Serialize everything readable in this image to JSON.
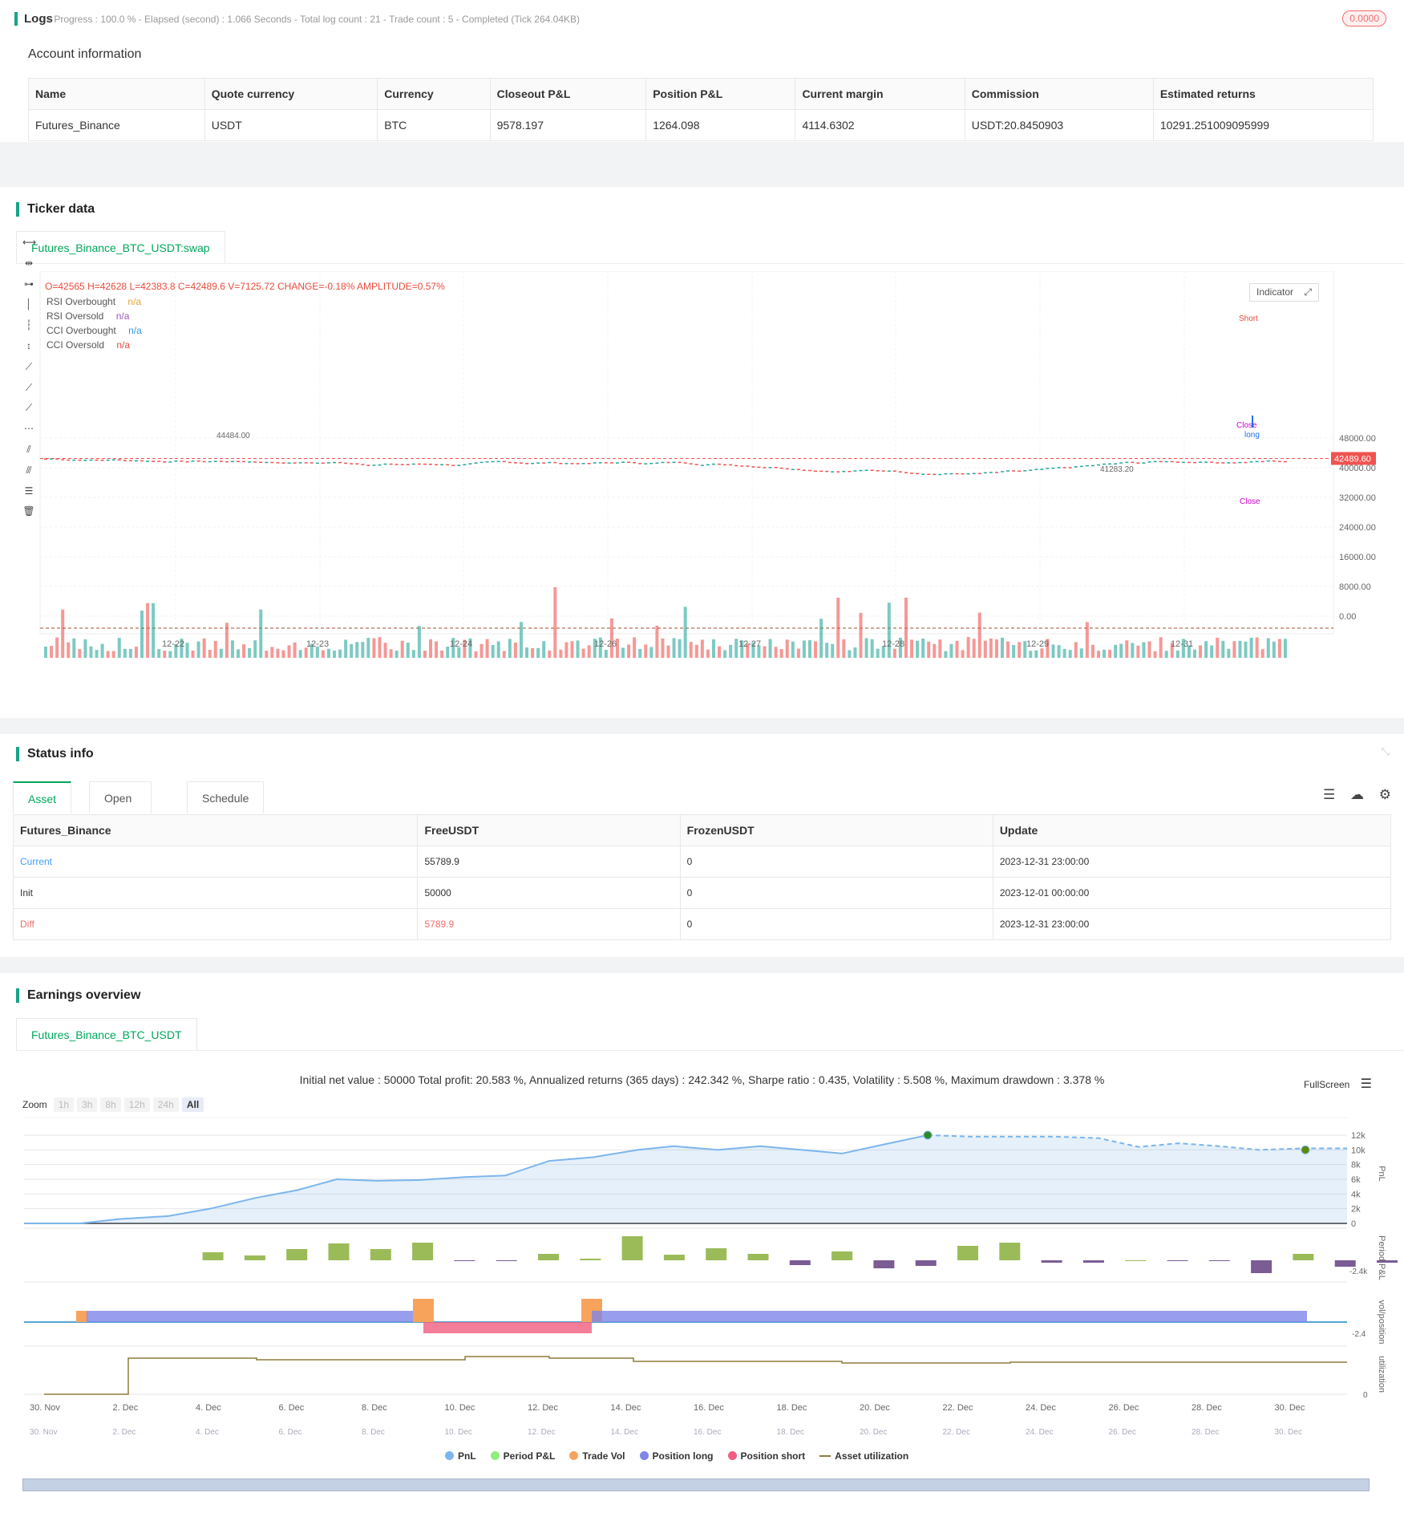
{
  "logs": {
    "title": "Logs",
    "status": "- Progress : 100.0 % - Elapsed (second) : 1.066  Seconds - Total log count : 21 - Trade count : 5 - Completed (Tick 264.04KB)",
    "badge": "0.0000"
  },
  "account": {
    "title": "Account information",
    "headers": [
      "Name",
      "Quote currency",
      "Currency",
      "Closeout P&L",
      "Position P&L",
      "Current margin",
      "Commission",
      "Estimated returns"
    ],
    "row": [
      "Futures_Binance",
      "USDT",
      "BTC",
      "9578.197",
      "1264.098",
      "4114.6302",
      "USDT:20.8450903",
      "10291.251009095999"
    ]
  },
  "ticker": {
    "title": "Ticker data",
    "tab": "Futures_Binance_BTC_USDT:swap",
    "ohlc": {
      "o": "O=42565",
      "h": "H=42628",
      "l": "L=42383.8",
      "c": "C=42489.6",
      "v": "V=7125.72",
      "change": "CHANGE=-0.18%",
      "amp": "AMPLITUDE=0.57%"
    },
    "indicators": [
      {
        "name": "RSI Overbought",
        "value": "n/a",
        "color": "#e6a23c"
      },
      {
        "name": "RSI Oversold",
        "value": "n/a",
        "color": "#9b59b6"
      },
      {
        "name": "CCI Overbought",
        "value": "n/a",
        "color": "#3498db"
      },
      {
        "name": "CCI Oversold",
        "value": "n/a",
        "color": "#e74c3c"
      }
    ],
    "indicator_btn": "Indicator",
    "price_axis": [
      "48000.00",
      "40000.00",
      "32000.00",
      "24000.00",
      "16000.00",
      "8000.00",
      "0.00"
    ],
    "current_price": "42489.60",
    "high_label": "44484.00",
    "low_label": "41283.20",
    "dates": [
      "12-22",
      "12-23",
      "12-24",
      "12-26",
      "12-27",
      "12-28",
      "12-29",
      "12-31"
    ],
    "marks": {
      "long": "long",
      "close": "Close",
      "short": "Short"
    }
  },
  "status": {
    "title": "Status info",
    "tabs": [
      "Asset",
      "Open orders",
      "Schedule orders"
    ],
    "headers": [
      "Futures_Binance",
      "FreeUSDT",
      "FrozenUSDT",
      "Update"
    ],
    "rows": [
      [
        "Current",
        "55789.9",
        "0",
        "2023-12-31 23:00:00"
      ],
      [
        "Init",
        "50000",
        "0",
        "2023-12-01 00:00:00"
      ],
      [
        "Diff",
        "5789.9",
        "0",
        "2023-12-31 23:00:00"
      ]
    ]
  },
  "earnings": {
    "title": "Earnings overview",
    "tab": "Futures_Binance_BTC_USDT",
    "summary": "Initial net value : 50000 Total profit: 20.583 %, Annualized returns (365 days) : 242.342 %, Sharpe ratio : 0.435, Volatility : 5.508 %, Maximum drawdown : 3.378 %",
    "fullscreen": "FullScreen",
    "zoom_label": "Zoom",
    "zoom": [
      "1h",
      "3h",
      "8h",
      "12h",
      "24h",
      "All"
    ],
    "pnl_axis": [
      "12k",
      "10k",
      "8k",
      "6k",
      "4k",
      "2k",
      "0"
    ],
    "axis_titles": [
      "PnL",
      "Period P&L",
      "vol/position",
      "utilization"
    ],
    "neg_label": "-2.4k",
    "neg_label2": "-2.4",
    "util_zero": "0",
    "dates": [
      "30. Nov",
      "2. Dec",
      "4. Dec",
      "6. Dec",
      "8. Dec",
      "10. Dec",
      "12. Dec",
      "14. Dec",
      "16. Dec",
      "18. Dec",
      "20. Dec",
      "22. Dec",
      "24. Dec",
      "26. Dec",
      "28. Dec",
      "30. Dec"
    ],
    "legend": [
      {
        "name": "PnL",
        "color": "#7cb5ec"
      },
      {
        "name": "Period P&L",
        "color": "#90ed7d"
      },
      {
        "name": "Trade Vol",
        "color": "#f7a35c"
      },
      {
        "name": "Position long",
        "color": "#8085e9"
      },
      {
        "name": "Position short",
        "color": "#f15c80"
      },
      {
        "name": "Asset utilization",
        "color": "#8d7b3c"
      }
    ]
  }
}
